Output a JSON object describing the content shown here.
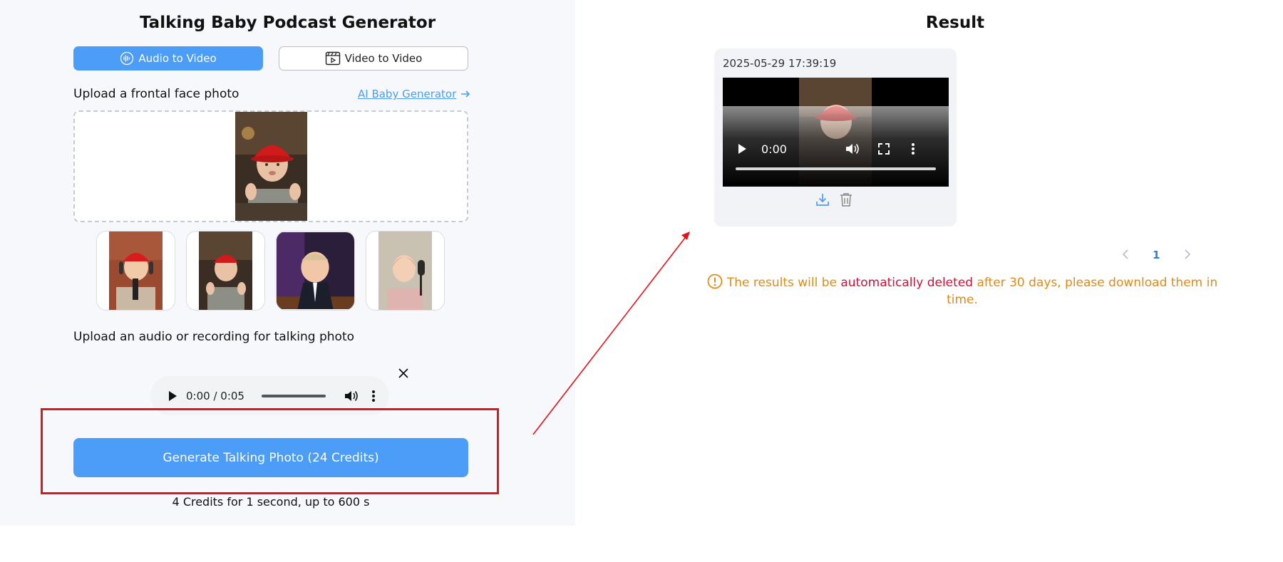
{
  "left": {
    "title": "Talking Baby Podcast Generator",
    "tabs": [
      {
        "label": "Audio to Video",
        "icon": "audio-wave-icon",
        "active": true
      },
      {
        "label": "Video to Video",
        "icon": "film-icon",
        "active": false
      }
    ],
    "photo_section": {
      "label": "Upload a frontal face photo",
      "link_label": "AI Baby Generator",
      "link_icon": "arrow-right-icon"
    },
    "sample_thumbs": [
      {
        "name": "baby-red-cap-headphones"
      },
      {
        "name": "baby-red-cap-waving"
      },
      {
        "name": "baby-in-suit"
      },
      {
        "name": "baby-girl-microphone"
      }
    ],
    "audio_section": {
      "label": "Upload an audio or recording for talking photo",
      "time": "0:00 / 0:05"
    },
    "generate_button": "Generate Talking Photo (24 Credits)",
    "credits_note": "4 Credits for 1 second, up to 600 s"
  },
  "result": {
    "title": "Result",
    "items": [
      {
        "timestamp": "2025-05-29 17:39:19",
        "video_time": "0:00",
        "actions": [
          "download-icon",
          "trash-icon"
        ]
      }
    ],
    "pagination": {
      "current": "1"
    },
    "notice": {
      "part1": "The results will be ",
      "highlight": "automatically deleted",
      "part2": " after 30 days",
      "part3": ", please download them in time."
    }
  },
  "colors": {
    "accent": "#4c9df8",
    "annotation_red": "#e3141b",
    "notice_orange": "#e18a14",
    "notice_red": "#d0103a"
  }
}
